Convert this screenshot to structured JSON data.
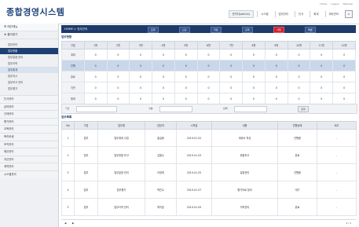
{
  "app": {
    "title": "종합경영시스템"
  },
  "header": {
    "util_links": [
      "Home",
      "Logout",
      "Sitemap"
    ],
    "user": "관리자(admin)",
    "menu": [
      "시스템",
      "업무관리",
      "인사",
      "회계",
      "재무관리"
    ],
    "close_label": "x"
  },
  "sidebar": {
    "sections": [
      {
        "label": "메인메뉴"
      },
      {
        "label": "즐겨찾기"
      }
    ],
    "items": [
      {
        "label": "업무관리"
      },
      {
        "label": "업무현황"
      },
      {
        "label": "업무일정 관리"
      },
      {
        "label": "업무이력"
      },
      {
        "label": "업무통계"
      },
      {
        "label": "업무지시"
      },
      {
        "label": "업무보고 관리"
      },
      {
        "label": "업무평가"
      }
    ],
    "groups": [
      "인사관리",
      "급여관리",
      "근태관리",
      "평가관리",
      "교육관리",
      "복리후생",
      "조직관리",
      "예산관리",
      "자산관리",
      "계약관리",
      "시스템관리"
    ]
  },
  "main": {
    "breadcrumb": "HOME > 업무관리",
    "toolbar": [
      "조회",
      "신규",
      "저장",
      "출력",
      "삭제",
      "엑셀"
    ],
    "top_section": "업무현황",
    "top_headers": [
      "구분",
      "1월",
      "2월",
      "3월",
      "4월",
      "5월",
      "6월",
      "7월",
      "8월",
      "9월",
      "10월",
      "11월",
      "12월"
    ],
    "top_rows": [
      {
        "label": "계획",
        "cells": [
          "0",
          "0",
          "0",
          "0",
          "0",
          "0",
          "0",
          "0",
          "0",
          "0",
          "0",
          "0"
        ]
      },
      {
        "label": "진행",
        "cells": [
          "0",
          "0",
          "0",
          "0",
          "0",
          "0",
          "0",
          "0",
          "0",
          "0",
          "0",
          "0"
        ]
      },
      {
        "label": "완료",
        "cells": [
          "0",
          "0",
          "0",
          "0",
          "0",
          "0",
          "0",
          "0",
          "0",
          "0",
          "0",
          "0"
        ]
      },
      {
        "label": "지연",
        "cells": [
          "0",
          "0",
          "0",
          "0",
          "0",
          "0",
          "0",
          "0",
          "0",
          "0",
          "0",
          "0"
        ]
      },
      {
        "label": "합계",
        "cells": [
          "0",
          "0",
          "0",
          "0",
          "0",
          "0",
          "0",
          "0",
          "0",
          "0",
          "0",
          "0"
        ]
      }
    ],
    "filter": {
      "label1": "기간",
      "label2": "구분",
      "label3": "상태",
      "search": "검색"
    },
    "bottom_section": "업무목록",
    "bottom_headers": [
      "No",
      "구분",
      "업무명",
      "담당자",
      "시작일",
      "내용",
      "진행상태",
      "비고"
    ],
    "bottom_rows": [
      {
        "cells": [
          "1",
          "업무",
          "업무계획 수립",
          "홍길동",
          "2019-01-02",
          "계획서 작성",
          "진행중",
          "-"
        ]
      },
      {
        "cells": [
          "2",
          "업무",
          "업무현황 보고",
          "김철수",
          "2019-01-03",
          "현황보고",
          "완료",
          "-"
        ]
      },
      {
        "cells": [
          "3",
          "업무",
          "업무일정 관리",
          "이영희",
          "2019-01-05",
          "일정관리",
          "진행중",
          "-"
        ]
      },
      {
        "cells": [
          "4",
          "업무",
          "업무평가",
          "박민수",
          "2019-01-07",
          "평가자료 정리",
          "대기",
          "-"
        ]
      },
      {
        "cells": [
          "5",
          "업무",
          "업무이력 관리",
          "최지훈",
          "2019-01-09",
          "이력관리",
          "완료",
          "-"
        ]
      }
    ],
    "pager": "1 / 1"
  }
}
